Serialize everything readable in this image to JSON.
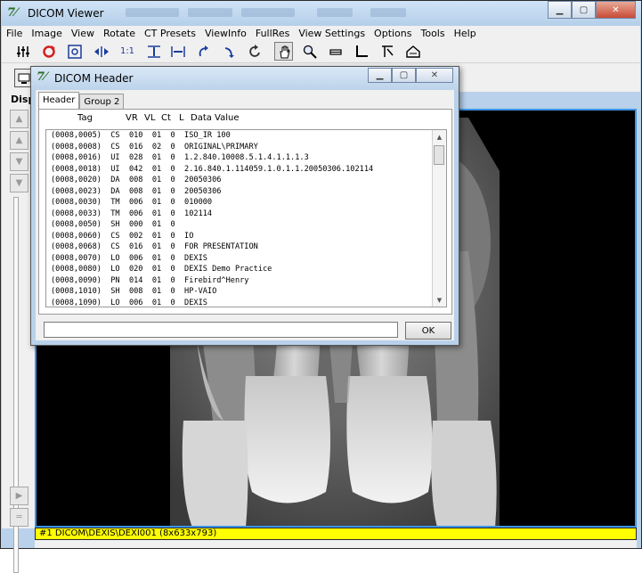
{
  "app": {
    "title": "DICOM Viewer"
  },
  "menu": [
    "File",
    "Image",
    "View",
    "Rotate",
    "CT Presets",
    "ViewInfo",
    "FullRes",
    "View Settings",
    "Options",
    "Tools",
    "Help"
  ],
  "toolbar": {
    "fit_label": "1:1",
    "icons": [
      "levels-icon",
      "reset-icon",
      "fit-window-icon",
      "flip-horizontal-icon",
      "actual-size-icon",
      "flip-vertical-icon",
      "fit-width-icon",
      "rotate-left-icon",
      "rotate-right-icon",
      "rotate-cw-icon",
      "pan-icon",
      "zoom-icon",
      "magnify-icon",
      "measure-icon",
      "angle-icon",
      "pixel-value-icon",
      "roi-icon"
    ]
  },
  "left_panel": {
    "label": "Displ"
  },
  "status": {
    "text": "#1 DICOM\\DEXIS\\DEXI001   (8x633x793)"
  },
  "dialog": {
    "title": "DICOM Header",
    "tabs": [
      "Header",
      "Group 2"
    ],
    "columns": {
      "tag": "Tag",
      "vr": "VR",
      "vl": "VL",
      "ct": "Ct",
      "l": "L",
      "value": "Data Value"
    },
    "rows": [
      "(0008,0005)  CS  010  01  0  ISO_IR 100",
      "(0008,0008)  CS  016  02  0  ORIGINAL\\PRIMARY",
      "(0008,0016)  UI  028  01  0  1.2.840.10008.5.1.4.1.1.1.3",
      "(0008,0018)  UI  042  01  0  2.16.840.1.114059.1.0.1.1.20050306.102114",
      "(0008,0020)  DA  008  01  0  20050306",
      "(0008,0023)  DA  008  01  0  20050306",
      "(0008,0030)  TM  006  01  0  010000",
      "(0008,0033)  TM  006  01  0  102114",
      "(0008,0050)  SH  000  01  0",
      "(0008,0060)  CS  002  01  0  IO",
      "(0008,0068)  CS  016  01  0  FOR PRESENTATION",
      "(0008,0070)  LO  006  01  0  DEXIS",
      "(0008,0080)  LO  020  01  0  DEXIS Demo Practice",
      "(0008,0090)  PN  014  01  0  Firebird^Henry",
      "(0008,1010)  SH  008  01  0  HP-VAIO",
      "(0008,1090)  LO  006  01  0  DEXIS"
    ],
    "ok_label": "OK"
  },
  "colors": {
    "status_bg": "#ffff00",
    "viewer_border": "#3d95e6",
    "title_bg": "#b9d1ea"
  }
}
